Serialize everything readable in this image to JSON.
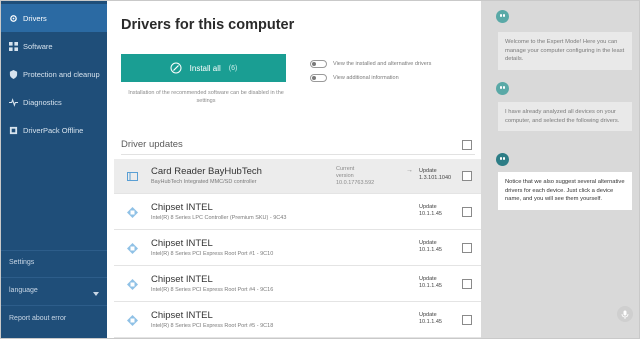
{
  "sidebar": {
    "items": [
      {
        "label": "Drivers",
        "icon": "gear-icon",
        "active": true
      },
      {
        "label": "Software",
        "icon": "grid-icon",
        "active": false
      },
      {
        "label": "Protection and cleanup",
        "icon": "shield-icon",
        "active": false
      },
      {
        "label": "Diagnostics",
        "icon": "pulse-icon",
        "active": false
      },
      {
        "label": "DriverPack Offline",
        "icon": "download-icon",
        "active": false
      }
    ],
    "settings_label": "Settings",
    "language_label": "language",
    "report_label": "Report about error"
  },
  "main": {
    "title": "Drivers for this computer",
    "install_button": "Install all",
    "install_badge": "(6)",
    "install_note": "Installation of the recommended software can be disabled in the settings",
    "toggle_installed": "View the installed and alternative drivers",
    "toggle_additional": "View additional information",
    "section_title": "Driver updates"
  },
  "drivers": [
    {
      "name": "Card Reader BayHubTech",
      "desc": "BayHubTech Integrated MMC/SD controller",
      "current_label": "Current",
      "current_version_label": "version",
      "current_version": "10.0.17763.592",
      "update_label": "Update",
      "update_version": "1.3.101.1040",
      "icon": "folder-icon"
    },
    {
      "name": "Chipset INTEL",
      "desc": "Intel(R) 8 Series LPC Controller (Premium SKU) - 9C43",
      "update_label": "Update",
      "update_version": "10.1.1.45",
      "icon": "chip-icon"
    },
    {
      "name": "Chipset INTEL",
      "desc": "Intel(R) 8 Series PCI Express Root Port #1 - 9C10",
      "update_label": "Update",
      "update_version": "10.1.1.45",
      "icon": "chip-icon"
    },
    {
      "name": "Chipset INTEL",
      "desc": "Intel(R) 8 Series PCI Express Root Port #4 - 9C16",
      "update_label": "Update",
      "update_version": "10.1.1.45",
      "icon": "chip-icon"
    },
    {
      "name": "Chipset INTEL",
      "desc": "Intel(R) 8 Series PCI Express Root Port #5 - 9C18",
      "update_label": "Update",
      "update_version": "10.1.1.45",
      "icon": "chip-icon"
    }
  ],
  "assistant": {
    "messages": [
      "Welcome to the Expert Mode! Here you can manage your computer configuring in the least details.",
      "I have already analyzed all devices on your computer, and selected the following drivers.",
      "Notice that we also suggest several alternative drivers for each device. Just click a device name, and you will see them yourself."
    ]
  },
  "colors": {
    "sidebar": "#1f4e79",
    "sidebar_active": "#2b6aa3",
    "install_button": "#1a9e93",
    "assistant_avatar": "#5aa9a7"
  }
}
